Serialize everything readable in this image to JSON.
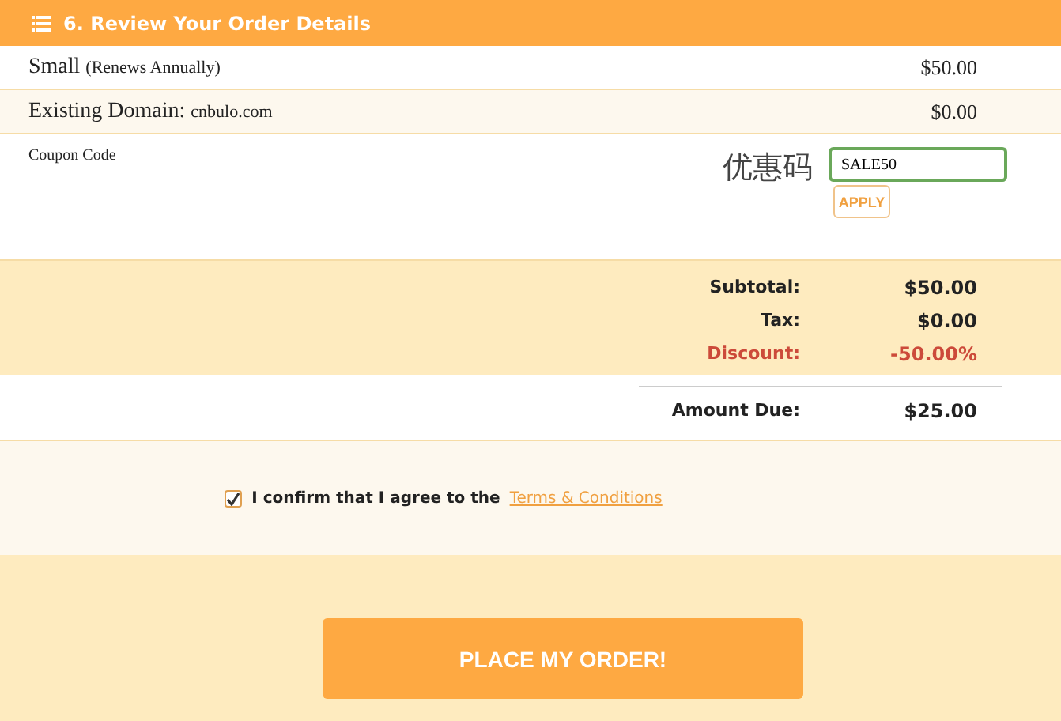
{
  "header": {
    "title": "6. Review Your Order Details"
  },
  "items": [
    {
      "name": "Small",
      "note": "(Renews Annually)",
      "price": "$50.00"
    },
    {
      "name": "Existing Domain:",
      "note": "cnbulo.com",
      "price": "$0.00"
    }
  ],
  "coupon": {
    "label": "Coupon Code",
    "annotation": "优惠码",
    "value": "SALE50",
    "button": "APPLY"
  },
  "totals": [
    {
      "kind": "normal",
      "label": "Subtotal:",
      "value": "$50.00"
    },
    {
      "kind": "normal",
      "label": "Tax:",
      "value": "$0.00"
    },
    {
      "kind": "discount",
      "label": "Discount:",
      "value": "-50.00%"
    }
  ],
  "amount_due": {
    "label": "Amount Due:",
    "value": "$25.00"
  },
  "confirm": {
    "checked": true,
    "text": "I confirm that I agree to the",
    "link": "Terms & Conditions"
  },
  "order_button": "PLACE MY ORDER!"
}
